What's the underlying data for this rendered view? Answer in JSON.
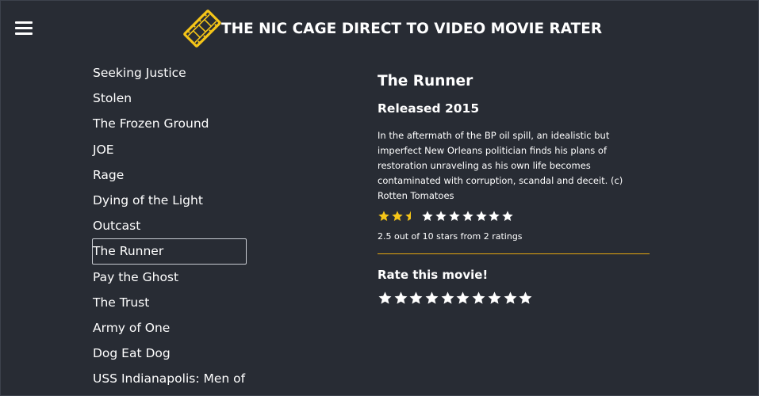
{
  "header": {
    "title": "THE NIC CAGE DIRECT TO VIDEO MOVIE RATER",
    "menu_icon": "hamburger-menu-icon",
    "logo_icon": "film-strip-icon",
    "accent_color": "#f5c518"
  },
  "movies": [
    "Seeking Justice",
    "Stolen",
    "The Frozen Ground",
    "JOE",
    "Rage",
    "Dying of the Light",
    "Outcast",
    "The Runner",
    "Pay the Ghost",
    "The Trust",
    "Army of One",
    "Dog Eat Dog",
    "USS Indianapolis: Men of"
  ],
  "selected_movie": "The Runner",
  "details": {
    "title": "The Runner",
    "released": "Released 2015",
    "description": "In the aftermath of the BP oil spill, an idealistic but imperfect New Orleans politician finds his plans of restoration unraveling as his own life becomes contaminated with corruption, scandal and deceit. (c) Rotten Tomatoes",
    "rating_value": 2.5,
    "rating_max": 10,
    "rating_text": "2.5 out of 10 stars from 2 ratings",
    "rate_label": "Rate this movie!",
    "rate_star_count": 10
  },
  "colors": {
    "background": "#282c34",
    "star_filled": "#f5c518",
    "star_empty": "#ffffff",
    "divider": "#e5a80f"
  }
}
